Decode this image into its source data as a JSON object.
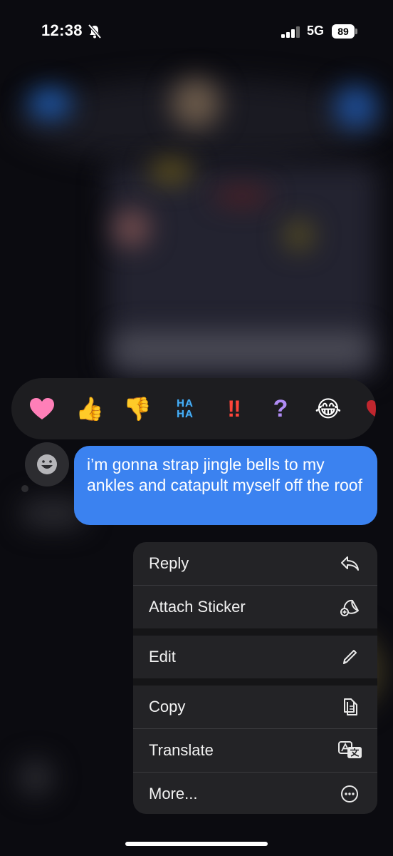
{
  "status_bar": {
    "time": "12:38",
    "network": "5G",
    "battery": "89",
    "silent_icon": "bell-slash-icon"
  },
  "reactions": [
    {
      "name": "heart",
      "glyph": "🩷"
    },
    {
      "name": "thumbs-up",
      "glyph": "👍"
    },
    {
      "name": "thumbs-down",
      "glyph": "👎"
    },
    {
      "name": "haha",
      "line1": "HA",
      "line2": "HA"
    },
    {
      "name": "exclamation",
      "glyph": "‼"
    },
    {
      "name": "question",
      "glyph": "?"
    },
    {
      "name": "laughing",
      "glyph": "😂"
    }
  ],
  "message": {
    "text": "i’m gonna strap jingle bells to my ankles and catapult myself off the roof",
    "bubble_color": "#3b82f0"
  },
  "menu": {
    "items": [
      {
        "label": "Reply",
        "icon": "reply-arrow-icon"
      },
      {
        "label": "Attach Sticker",
        "icon": "sticker-add-icon"
      },
      {
        "label": "Edit",
        "icon": "pencil-icon"
      },
      {
        "label": "Copy",
        "icon": "copy-documents-icon"
      },
      {
        "label": "Translate",
        "icon": "translate-icon"
      },
      {
        "label": "More...",
        "icon": "ellipsis-circle-icon"
      }
    ]
  }
}
